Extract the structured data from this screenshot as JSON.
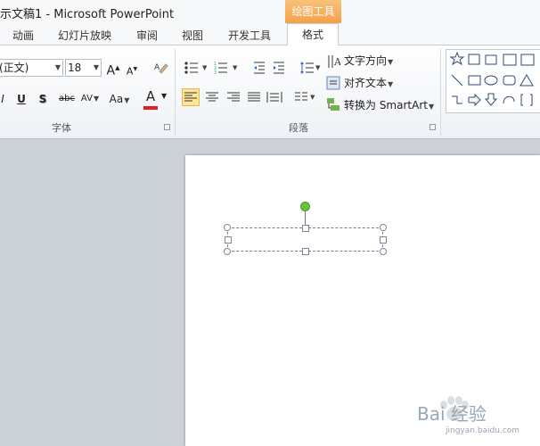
{
  "window": {
    "title": "示文稿1 - Microsoft PowerPoint",
    "context_tab_group": "绘图工具"
  },
  "tabs": [
    {
      "label": "动画"
    },
    {
      "label": "幻灯片放映"
    },
    {
      "label": "审阅"
    },
    {
      "label": "视图"
    },
    {
      "label": "开发工具"
    },
    {
      "label": "格式",
      "selected": true
    }
  ],
  "font_group": {
    "font_name": "(正文)",
    "font_size": "18",
    "grow_label": "A",
    "shrink_label": "A",
    "italic": "I",
    "underline": "U",
    "shadow": "S",
    "strike": "abc",
    "spacing": "AV",
    "case": "Aa",
    "color_label": "A",
    "font_color": "#e02020",
    "group_label": "字体"
  },
  "paragraph_group": {
    "text_direction": "文字方向",
    "align_text": "对齐文本",
    "convert_smartart": "转换为 SmartArt",
    "group_label": "段落",
    "active_alignment": "left"
  },
  "colors": {
    "context_tab": "#f2a24a",
    "rotation_handle": "#6fbf3f",
    "align_highlight": "#fde59a"
  },
  "watermark": {
    "text": "Bai 经验",
    "sub": "jingyan.baidu.com"
  }
}
